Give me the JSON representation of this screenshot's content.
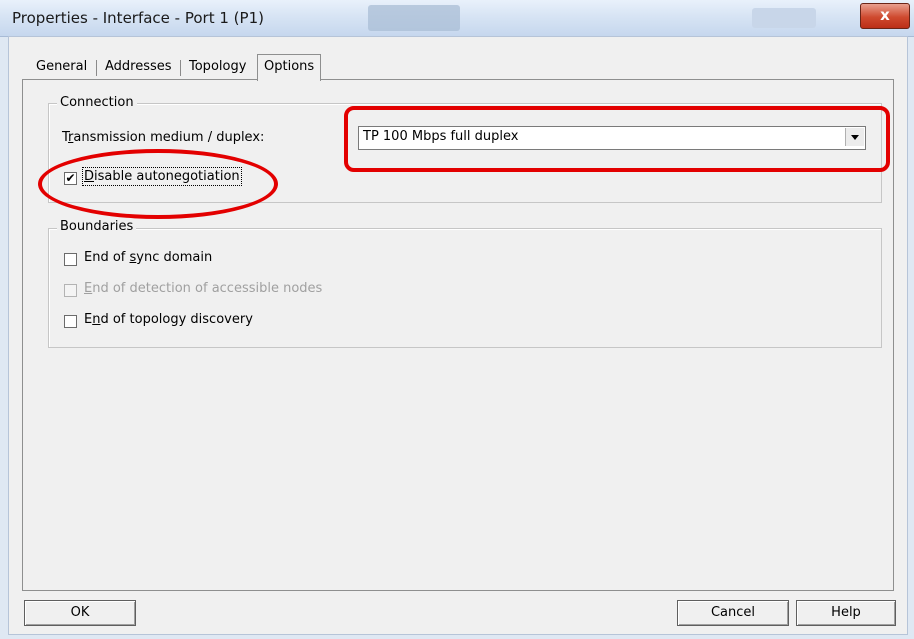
{
  "window": {
    "title": "Properties - Interface - Port 1 (P1)",
    "close_label": "x"
  },
  "tabs": [
    {
      "label": "General",
      "active": false
    },
    {
      "label": "Addresses",
      "active": false
    },
    {
      "label": "Topology",
      "active": false
    },
    {
      "label": "Options",
      "active": true
    }
  ],
  "connection": {
    "group_title": "Connection",
    "medium_label_pre": "T",
    "medium_label_key": "r",
    "medium_label_post": "ansmission medium / duplex:",
    "medium_value": "TP 100 Mbps full duplex",
    "disable_autoneg": {
      "key": "D",
      "rest": "isable autonegotiation",
      "checked": true
    }
  },
  "boundaries": {
    "group_title": "Boundaries",
    "items": [
      {
        "pre": "End of ",
        "key": "s",
        "post": "ync domain",
        "checked": false,
        "enabled": true
      },
      {
        "pre": "",
        "key": "E",
        "post": "nd of detection of accessible nodes",
        "checked": false,
        "enabled": false
      },
      {
        "pre": "E",
        "key": "n",
        "post": "d of topology discovery",
        "checked": false,
        "enabled": true
      }
    ]
  },
  "buttons": {
    "ok": "OK",
    "cancel": "Cancel",
    "help": "Help"
  },
  "colors": {
    "annotation": "#e30000",
    "close_button": "#cf4a2f"
  },
  "icons": {
    "check": "✔",
    "dropdown": "chevron-down-icon"
  }
}
